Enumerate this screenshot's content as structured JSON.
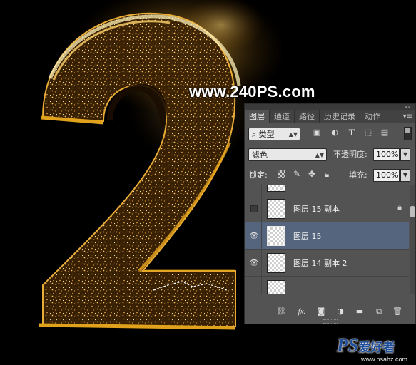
{
  "artwork": {
    "digit": "2",
    "watermark": "www.240PS.com",
    "glow_color": "#f5b63a",
    "edge_color": "#e0a21c"
  },
  "panel": {
    "tabs": [
      "图层",
      "通道",
      "路径",
      "历史记录",
      "动作"
    ],
    "active_tab": "图层",
    "filter": {
      "label": "类型"
    },
    "blend_mode": "滤色",
    "opacity_label": "不透明度:",
    "opacity_value": "100%",
    "lock_label": "锁定:",
    "fill_label": "填充:",
    "fill_value": "100%",
    "layers": [
      {
        "name": "图层 15 副本",
        "visible": false,
        "locked": true,
        "selected": false
      },
      {
        "name": "图层 15",
        "visible": true,
        "locked": false,
        "selected": true
      },
      {
        "name": "图层 14 副本 2",
        "visible": true,
        "locked": false,
        "selected": false
      }
    ],
    "selection_color": "#55657d"
  },
  "logo": {
    "ps": "PS",
    "cn": "爱好者",
    "url": "www.psahz.com"
  }
}
